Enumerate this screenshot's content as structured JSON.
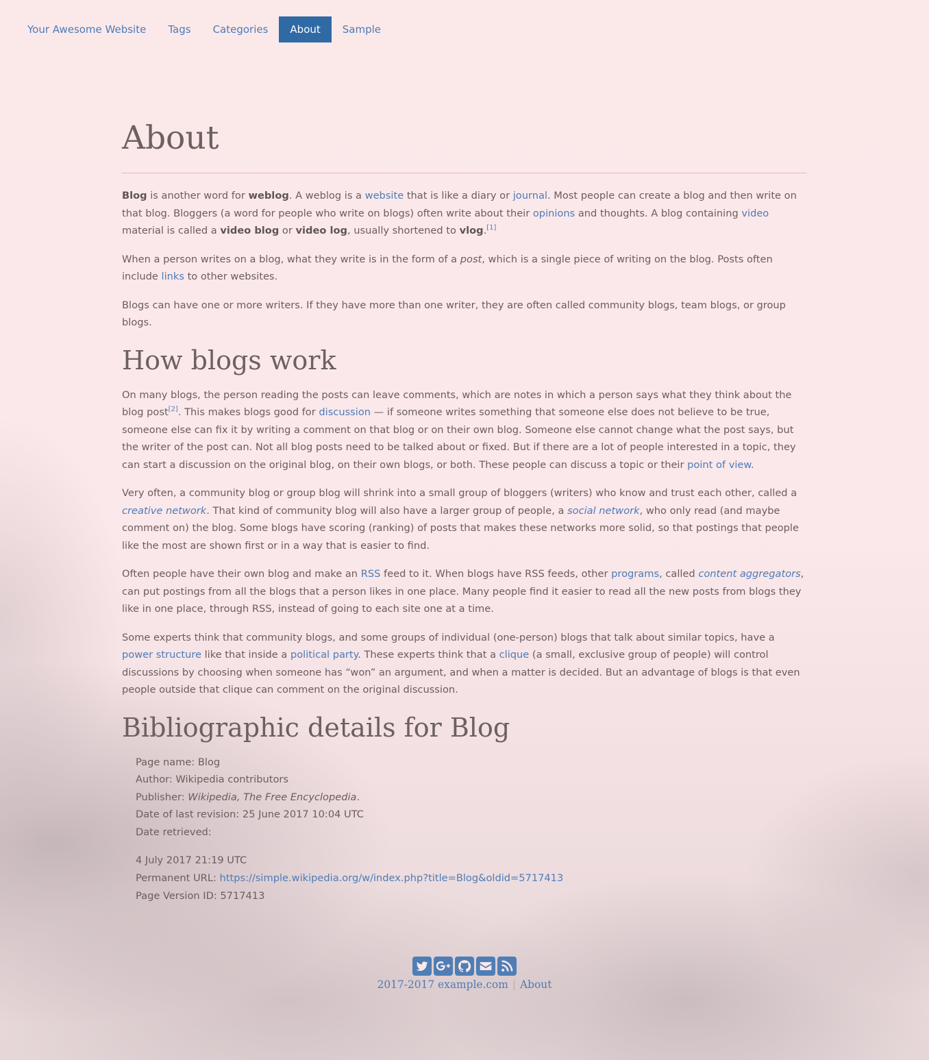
{
  "nav": {
    "items": [
      {
        "label": "Your Awesome Website",
        "active": false
      },
      {
        "label": "Tags",
        "active": false
      },
      {
        "label": "Categories",
        "active": false
      },
      {
        "label": "About",
        "active": true
      },
      {
        "label": "Sample",
        "active": false
      }
    ]
  },
  "page": {
    "title": "About",
    "intro": {
      "p1": {
        "t1_bold": "Blog",
        "t2": " is another word for ",
        "t3_bold": "weblog",
        "t4": ". A weblog is a ",
        "l_website": "website",
        "t5": " that is like a diary or ",
        "l_journal": "journal",
        "t6": ". Most people can create a blog and then write on that blog. Bloggers (a word for people who write on blogs) often write about their ",
        "l_opinions": "opinions",
        "t7": " and thoughts. A blog containing ",
        "l_video": "video",
        "t8": " material is called a ",
        "b_video_blog": "video blog",
        "t9": " or ",
        "b_video_log": "video log",
        "t10": ", usually shortened to ",
        "b_vlog": "vlog",
        "t11": ".",
        "ref1": "[1]"
      },
      "p2": {
        "t1": "When a person writes on a blog, what they write is in the form of a ",
        "i_post": "post",
        "t2": ", which is a single piece of writing on the blog. Posts often include ",
        "l_links": "links",
        "t3": " to other websites."
      },
      "p3": "Blogs can have one or more writers. If they have more than one writer, they are often called community blogs, team blogs, or group blogs."
    },
    "how": {
      "heading": "How blogs work",
      "p1": {
        "t1": "On many blogs, the person reading the posts can leave comments, which are notes in which a person says what they think about the blog post",
        "ref2": "[2]",
        "t2": ". This makes blogs good for ",
        "l_discussion": "discussion",
        "t3": " — if someone writes something that someone else does not believe to be true, someone else can fix it by writing a comment on that blog or on their own blog. Someone else cannot change what the post says, but the writer of the post can. Not all blog posts need to be talked about or fixed. But if there are a lot of people interested in a topic, they can start a discussion on the original blog, on their own blogs, or both. These people can discuss a topic or their ",
        "l_pov": "point of view",
        "t4": "."
      },
      "p2": {
        "t1": "Very often, a community blog or group blog will shrink into a small group of bloggers (writers) who know and trust each other, called a ",
        "l_creative": "creative network",
        "t2": ". That kind of community blog will also have a larger group of people, a ",
        "l_social": "social network",
        "t3": ", who only read (and maybe comment on) the blog. Some blogs have scoring (ranking) of posts that makes these networks more solid, so that postings that people like the most are shown first or in a way that is easier to find."
      },
      "p3": {
        "t1": "Often people have their own blog and make an ",
        "l_rss": "RSS",
        "t2": " feed to it. When blogs have RSS feeds, other ",
        "l_programs": "programs",
        "t3": ", called ",
        "l_aggregators": "content aggregators",
        "t4": ", can put postings from all the blogs that a person likes in one place. Many people find it easier to read all the new posts from blogs they like in one place, through RSS, instead of going to each site one at a time."
      },
      "p4": {
        "t1": "Some experts think that community blogs, and some groups of individual (one-person) blogs that talk about similar topics, have a ",
        "l_power": "power structure",
        "t2": " like that inside a ",
        "l_party": "political party",
        "t3": ". These experts think that a ",
        "l_clique": "clique",
        "t4": " (a small, exclusive group of people) will control discussions by choosing when someone has “won” an argument, and when a matter is decided. But an advantage of blogs is that even people outside that clique can comment on the original discussion."
      }
    },
    "biblio": {
      "heading": "Bibliographic details for Blog",
      "page_name": "Page name: Blog",
      "author": "Author: Wikipedia contributors",
      "publisher_label": "Publisher: ",
      "publisher_name": "Wikipedia, The Free Encyclopedia",
      "publisher_end": ".",
      "last_revision": "Date of last revision: 25 June 2017 10:04 UTC",
      "date_retrieved_label": "Date retrieved:",
      "date_retrieved_value": "4 July 2017 21:19 UTC",
      "permanent_url_label": "Permanent URL: ",
      "permanent_url": "https://simple.wikipedia.org/w/index.php?title=Blog&oldid=5717413",
      "page_version": "Page Version ID: 5717413"
    }
  },
  "footer": {
    "icons": [
      "twitter-icon",
      "google-plus-icon",
      "github-icon",
      "envelope-icon",
      "rss-icon"
    ],
    "years": "2017-2017",
    "site": "example.com",
    "about": "About",
    "separator": "|"
  },
  "colors": {
    "link": "#4d7bb7",
    "nav_active_bg": "#2f6aa5",
    "text": "#6a5d5d",
    "background": "#fbe9ea",
    "heading_rule": "#e3b7be"
  }
}
